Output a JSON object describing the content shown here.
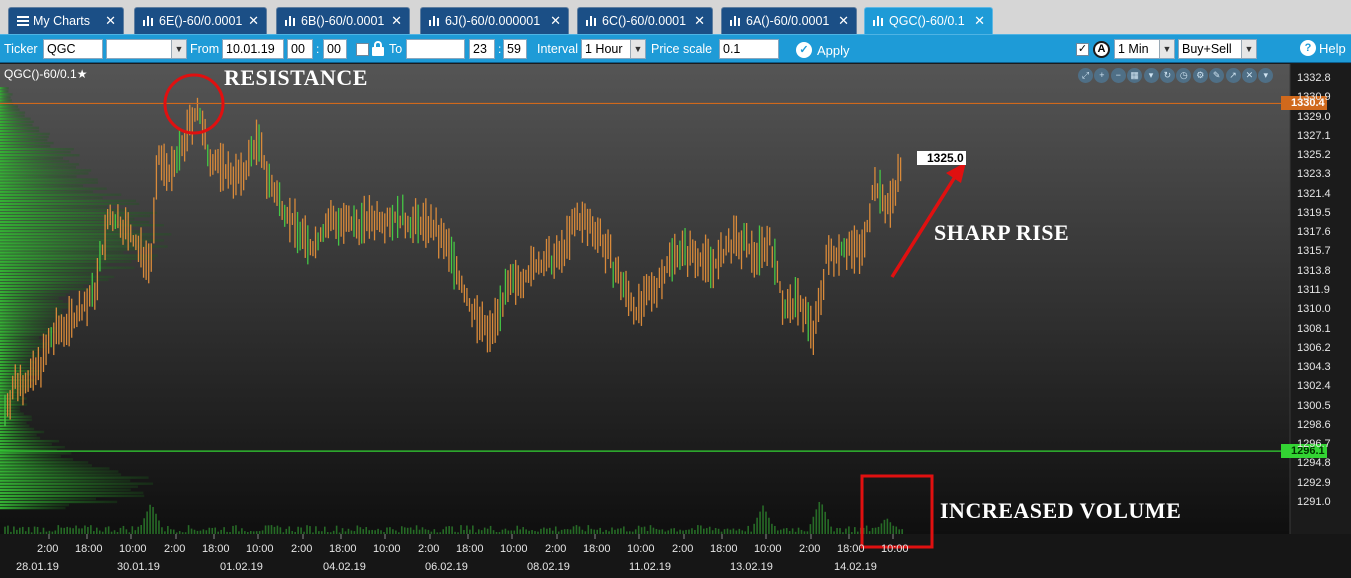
{
  "tabs": [
    {
      "label": "My Charts",
      "icon": "menu-icon",
      "active": false
    },
    {
      "label": "6E()-60/0.0001",
      "icon": "chart-icon",
      "active": false
    },
    {
      "label": "6B()-60/0.0001",
      "icon": "chart-icon",
      "active": false
    },
    {
      "label": "6J()-60/0.000001",
      "icon": "chart-icon",
      "active": false
    },
    {
      "label": "6C()-60/0.0001",
      "icon": "chart-icon",
      "active": false
    },
    {
      "label": "6A()-60/0.0001",
      "icon": "chart-icon",
      "active": false
    },
    {
      "label": "QGC()-60/0.1",
      "icon": "chart-icon",
      "active": true
    }
  ],
  "close_glyph": "✕",
  "toolbar": {
    "ticker_label": "Ticker",
    "ticker_value": "QGC",
    "from_label": "From",
    "from_date": "10.01.19",
    "from_hour": "00",
    "from_minute": "00",
    "to_label": "To",
    "to_date": "",
    "to_hour": "23",
    "to_minute": "59",
    "interval_label": "Interval",
    "interval_value": "1 Hour",
    "price_scale_label": "Price scale",
    "price_scale_value": "0.1",
    "apply_label": "Apply",
    "timeframe_value": "1 Min",
    "side_value": "Buy+Sell",
    "help_label": "Help",
    "auto_label": "A",
    "colon": ":"
  },
  "chart": {
    "symbol": "QGC()-60/0.1",
    "star": "★",
    "resistance_price": "1330.4",
    "support_price": "1296.1",
    "last_price": "1325.0",
    "colors": {
      "background_top": "#515151",
      "background_bottom": "#111111",
      "resistance_line": "#d0691c",
      "support_line": "#33d433",
      "candle": "#d98a3a",
      "candle_alt": "#45c745",
      "volume": "#2f8a2f",
      "profile": "#29a029",
      "annotation": "#e01010"
    }
  },
  "annotations": {
    "resistance": "RESISTANCE",
    "sharp_rise": "SHARP RISE",
    "increased_volume": "INCREASED VOLUME"
  },
  "axis": {
    "y_ticks": [
      "1332.8",
      "1330.9",
      "1329.0",
      "1327.1",
      "1325.2",
      "1323.3",
      "1321.4",
      "1319.5",
      "1317.6",
      "1315.7",
      "1313.8",
      "1311.9",
      "1310.0",
      "1308.1",
      "1306.2",
      "1304.3",
      "1302.4",
      "1300.5",
      "1298.6",
      "1296.7",
      "1294.8",
      "1292.9",
      "1291.0"
    ],
    "x_times": [
      "2:00",
      "18:00",
      "10:00",
      "2:00",
      "18:00",
      "10:00",
      "2:00",
      "18:00",
      "10:00",
      "2:00",
      "18:00",
      "10:00",
      "2:00",
      "18:00",
      "10:00",
      "2:00",
      "18:00",
      "10:00",
      "2:00",
      "18:00",
      "10:00"
    ],
    "x_dates": [
      "28.01.19",
      "30.01.19",
      "01.02.19",
      "04.02.19",
      "06.02.19",
      "08.02.19",
      "11.02.19",
      "13.02.19",
      "14.02.19"
    ]
  },
  "chart_data": {
    "type": "candlestick",
    "title": "QGC()-60/0.1",
    "interval": "1 Hour",
    "ylim": [
      1290.0,
      1333.5
    ],
    "resistance": 1330.4,
    "support": 1296.1,
    "last": 1325.0,
    "x_dates": [
      "28.01.19",
      "30.01.19",
      "01.02.19",
      "04.02.19",
      "06.02.19",
      "08.02.19",
      "11.02.19",
      "13.02.19",
      "14.02.19"
    ],
    "close_path": [
      [
        0,
        1300.2
      ],
      [
        10,
        1302.8
      ],
      [
        30,
        1303.5
      ],
      [
        50,
        1307.6
      ],
      [
        70,
        1309.3
      ],
      [
        90,
        1311.5
      ],
      [
        105,
        1319.0
      ],
      [
        120,
        1318.5
      ],
      [
        135,
        1316.0
      ],
      [
        148,
        1315.0
      ],
      [
        155,
        1325.0
      ],
      [
        170,
        1323.5
      ],
      [
        185,
        1327.5
      ],
      [
        195,
        1330.0
      ],
      [
        205,
        1325.5
      ],
      [
        220,
        1324.0
      ],
      [
        240,
        1323.0
      ],
      [
        255,
        1326.8
      ],
      [
        270,
        1322.0
      ],
      [
        290,
        1319.0
      ],
      [
        310,
        1316.0
      ],
      [
        330,
        1319.0
      ],
      [
        350,
        1318.2
      ],
      [
        370,
        1319.0
      ],
      [
        390,
        1319.2
      ],
      [
        410,
        1318.6
      ],
      [
        430,
        1318.5
      ],
      [
        450,
        1316.0
      ],
      [
        470,
        1310.5
      ],
      [
        490,
        1307.5
      ],
      [
        505,
        1311.3
      ],
      [
        520,
        1313.0
      ],
      [
        540,
        1314.5
      ],
      [
        560,
        1315.0
      ],
      [
        580,
        1319.0
      ],
      [
        600,
        1318.0
      ],
      [
        620,
        1313.5
      ],
      [
        640,
        1309.8
      ],
      [
        660,
        1312.5
      ],
      [
        680,
        1316.0
      ],
      [
        700,
        1315.5
      ],
      [
        720,
        1314.5
      ],
      [
        740,
        1317.0
      ],
      [
        760,
        1315.5
      ],
      [
        775,
        1317.0
      ],
      [
        790,
        1310.0
      ],
      [
        805,
        1311.0
      ],
      [
        820,
        1307.5
      ],
      [
        832,
        1315.0
      ],
      [
        850,
        1316.3
      ],
      [
        870,
        1316.0
      ],
      [
        880,
        1322.5
      ],
      [
        895,
        1320.0
      ],
      [
        910,
        1325.0
      ]
    ],
    "volume_peaks": [
      {
        "x": 148,
        "v": 42
      },
      {
        "x": 768,
        "v": 38
      },
      {
        "x": 826,
        "v": 46
      },
      {
        "x": 893,
        "v": 22
      }
    ]
  }
}
